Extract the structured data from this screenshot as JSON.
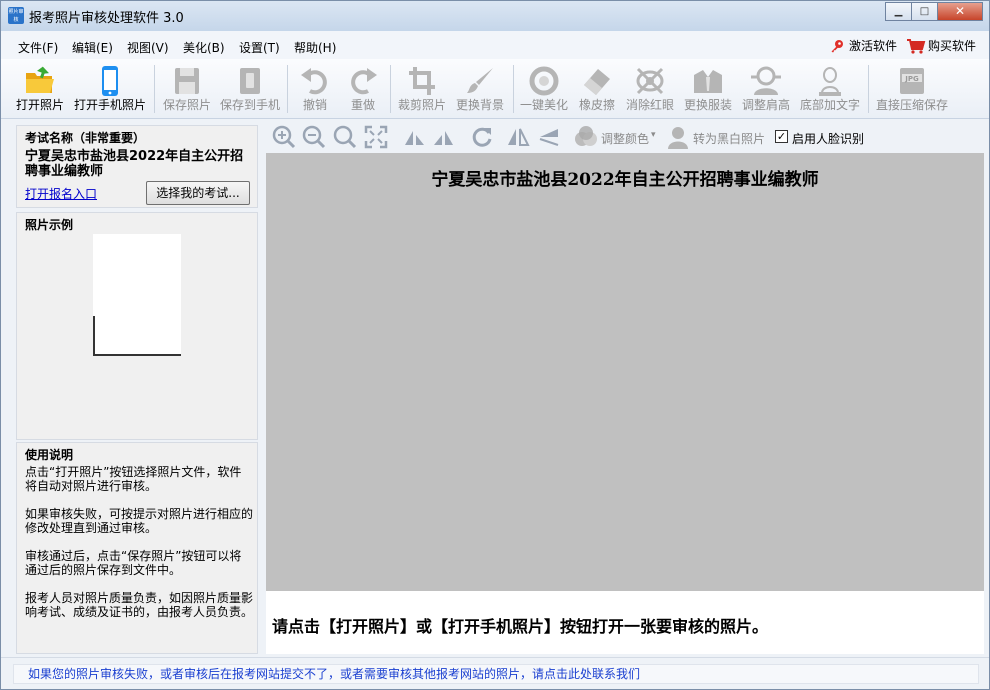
{
  "window": {
    "title": "报考照片审核处理软件 3.0",
    "app_icon_text": "照片审核",
    "controls": {
      "minimize": "▁",
      "maximize": "□",
      "close": "✕"
    }
  },
  "menu": {
    "items": [
      "文件(F)",
      "编辑(E)",
      "视图(V)",
      "美化(B)",
      "设置(T)",
      "帮助(H)"
    ],
    "activate": "激活软件",
    "buy": "购买软件"
  },
  "toolbar": {
    "items": [
      {
        "label": "打开照片",
        "icon": "folder-open-icon",
        "enabled": true
      },
      {
        "label": "打开手机照片",
        "icon": "phone-icon",
        "enabled": true
      },
      {
        "label": "保存照片",
        "icon": "save-icon",
        "enabled": false
      },
      {
        "label": "保存到手机",
        "icon": "save-to-phone-icon",
        "enabled": false
      },
      {
        "label": "撤销",
        "icon": "undo-icon",
        "enabled": false
      },
      {
        "label": "重做",
        "icon": "redo-icon",
        "enabled": false
      },
      {
        "label": "裁剪照片",
        "icon": "crop-icon",
        "enabled": false
      },
      {
        "label": "更换背景",
        "icon": "brush-icon",
        "enabled": false
      },
      {
        "label": "一键美化",
        "icon": "beautify-icon",
        "enabled": false
      },
      {
        "label": "橡皮擦",
        "icon": "eraser-icon",
        "enabled": false
      },
      {
        "label": "消除红眼",
        "icon": "red-eye-icon",
        "enabled": false
      },
      {
        "label": "更换服装",
        "icon": "clothes-icon",
        "enabled": false
      },
      {
        "label": "调整肩高",
        "icon": "shoulder-icon",
        "enabled": false
      },
      {
        "label": "底部加文字",
        "icon": "add-text-icon",
        "enabled": false
      },
      {
        "label": "直接压缩保存",
        "icon": "jpg-compress-icon",
        "enabled": false
      }
    ]
  },
  "left": {
    "exam": {
      "heading": "考试名称（非常重要）",
      "name": "宁夏吴忠市盐池县2022年自主公开招聘事业编教师",
      "link": "打开报名入口",
      "button": "选择我的考试..."
    },
    "sample": {
      "heading": "照片示例"
    },
    "usage": {
      "heading": "使用说明",
      "paragraphs": [
        "点击“打开照片”按钮选择照片文件，软件将自动对照片进行审核。",
        "如果审核失败，可按提示对照片进行相应的修改处理直到通过审核。",
        "审核通过后，点击“保存照片”按钮可以将通过后的照片保存到文件中。",
        "报考人员对照片质量负责，如因照片质量影响考试、成绩及证书的，由报考人员负责。"
      ]
    }
  },
  "imagebar": {
    "adjust_color": "调整颜色",
    "to_bw": "转为黑白照片",
    "face_detect": "启用人脸识别",
    "face_detect_checked": true
  },
  "canvas": {
    "title": "宁夏吴忠市盐池县2022年自主公开招聘事业编教师",
    "hint": "请点击【打开照片】或【打开手机照片】按钮打开一张要审核的照片。"
  },
  "status": {
    "link": "如果您的照片审核失败，或者审核后在报考网站提交不了，或者需要审核其他报考网站的照片，请点击此处联系我们"
  },
  "colors": {
    "link_blue": "#1a3fd0",
    "canvas_gray": "#c0c0c0",
    "disabled_gray": "#8e8e8e",
    "icon_blue": "#2a8ff0",
    "folder_yellow": "#f5b820"
  }
}
